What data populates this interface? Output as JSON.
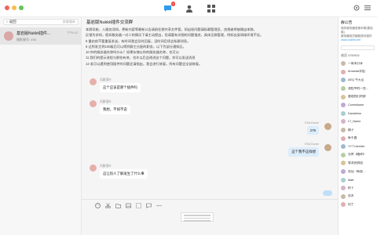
{
  "colors": {
    "window_red": "#f2635b",
    "window_yellow": "#f4be4f",
    "window_green": "#61c554",
    "accent_blue": "#2d9bf0",
    "badge_red": "#f0443c"
  },
  "topbar": {
    "badge_count": "1",
    "icons": [
      "chat-icon",
      "contacts-icon",
      "apps-icon",
      "settings-icon",
      "menu-icon"
    ]
  },
  "left": {
    "search": {
      "back_label": "返回",
      "left_label": "返回",
      "right_label": "群聊最新"
    },
    "conversation": {
      "name": "基岩版Nukkit插件...",
      "sub": "摄影服号: 498",
      "time": "下午6:42"
    }
  },
  "chat": {
    "title": "基岩版Nukkit插件交流群",
    "notice": [
      "本群导航，入服务须知，更新内容等最新公告请前往群共享文件管，如出现问题请私聊管理员，违规者将被踢出本群。",
      "反馈为求知，假如服务器一对二的情况下请主动提出，但请要有详细的问题描述，具体见群管理，例如自身网络环境不佳。",
      "5 重启前不要重复发送，有时间我会及时回复，没时间后续会私聊消息。",
      "6 达到发言到100级后可以得到群主分配的职务，以下为部分通知区。",
      "10 你的服务器名称叫什么？如果存储以你的服务器名称，也可以",
      "11 我们的提示进程与那些有关，也许以后会改进这个问题，你可以发送消息",
      "12 若可以遇到使用插件的问题还请指出，我会进行修复，所有问题会全部修复。"
    ],
    "messages": [
      {
        "name": "风飘落叶",
        "text": "这个应该是那个插件吗"
      },
      {
        "name": "风飘落叶",
        "text": "我想，不如不说"
      },
      {
        "name": "STarGame",
        "text": "279"
      },
      {
        "name": "STarGame",
        "text": "这个我不这样想"
      },
      {
        "name": "风飘落叶",
        "text": "这让别人了解发生了什么事"
      }
    ],
    "tools": [
      "emoji-icon",
      "scissors-icon",
      "folder-icon",
      "image-icon",
      "screenshot-icon",
      "chat-bubble-icon",
      "more-icon"
    ]
  },
  "right_panel": {
    "title": "群公告",
    "notice_lines": [
      "插件服务器资源本群(基岩版)",
      "服务器成员都能提问插件",
      "www.mcbbs.net"
    ],
    "count_label": "成员 476/924",
    "members": [
      "一周末分享",
      "Amanda学姐",
      "AEQ 今天见",
      "流程中的一些…",
      "整理我们的群",
      "Conrmikaze",
      "Dandelion",
      "LT_Name",
      "橘子",
      "新手路",
      "YYT minekin",
      "仓库【搬砖】",
      "零消息群组",
      "花仙（新版…",
      "Matt",
      "树下",
      "花木",
      "阿丁"
    ]
  }
}
